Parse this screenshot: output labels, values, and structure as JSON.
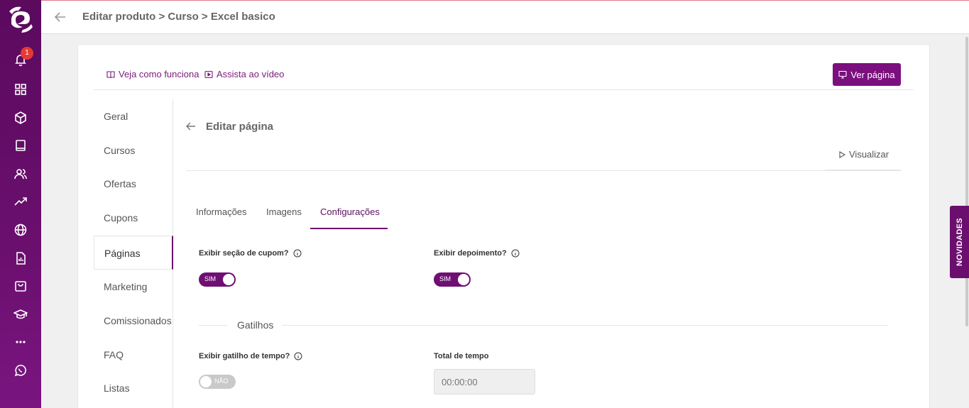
{
  "sidebar": {
    "notification_count": "1",
    "icons": [
      "bell-icon",
      "dashboard-grid-icon",
      "box-icon",
      "book-icon",
      "users-icon",
      "trending-up-icon",
      "globe-icon",
      "report-icon",
      "shopping-bag-icon",
      "graduation-cap-icon",
      "more-dots-icon",
      "whatsapp-icon"
    ]
  },
  "header": {
    "breadcrumb": "Editar produto > Curso > Excel basico"
  },
  "help": {
    "how_it_works": "Veja como funciona",
    "watch_video": "Assista ao vídeo"
  },
  "actions": {
    "view_page": "Ver página"
  },
  "subnav": {
    "items": [
      {
        "label": "Geral"
      },
      {
        "label": "Cursos"
      },
      {
        "label": "Ofertas"
      },
      {
        "label": "Cupons"
      },
      {
        "label": "Páginas"
      },
      {
        "label": "Marketing"
      },
      {
        "label": "Comissionados"
      },
      {
        "label": "FAQ"
      },
      {
        "label": "Listas"
      }
    ],
    "active": "Páginas"
  },
  "editor": {
    "title": "Editar página",
    "preview": "Visualizar"
  },
  "tabs": [
    {
      "label": "Informações"
    },
    {
      "label": "Imagens"
    },
    {
      "label": "Configurações"
    }
  ],
  "settings": {
    "coupon_label": "Exibir seção de cupom?",
    "coupon_toggle": "SIM",
    "testimonial_label": "Exibir depoimento?",
    "testimonial_toggle": "SIM",
    "triggers_title": "Gatilhos",
    "time_trigger_label": "Exibir gatilho de tempo?",
    "time_trigger_toggle": "NÃO",
    "total_time_label": "Total de tempo",
    "total_time_placeholder": "00:00:00"
  },
  "novidades": {
    "label": "NOVIDADES"
  },
  "colors": {
    "brand": "#6a0f6e",
    "brand_dark": "#5b0a5e",
    "badge": "#e53935"
  }
}
